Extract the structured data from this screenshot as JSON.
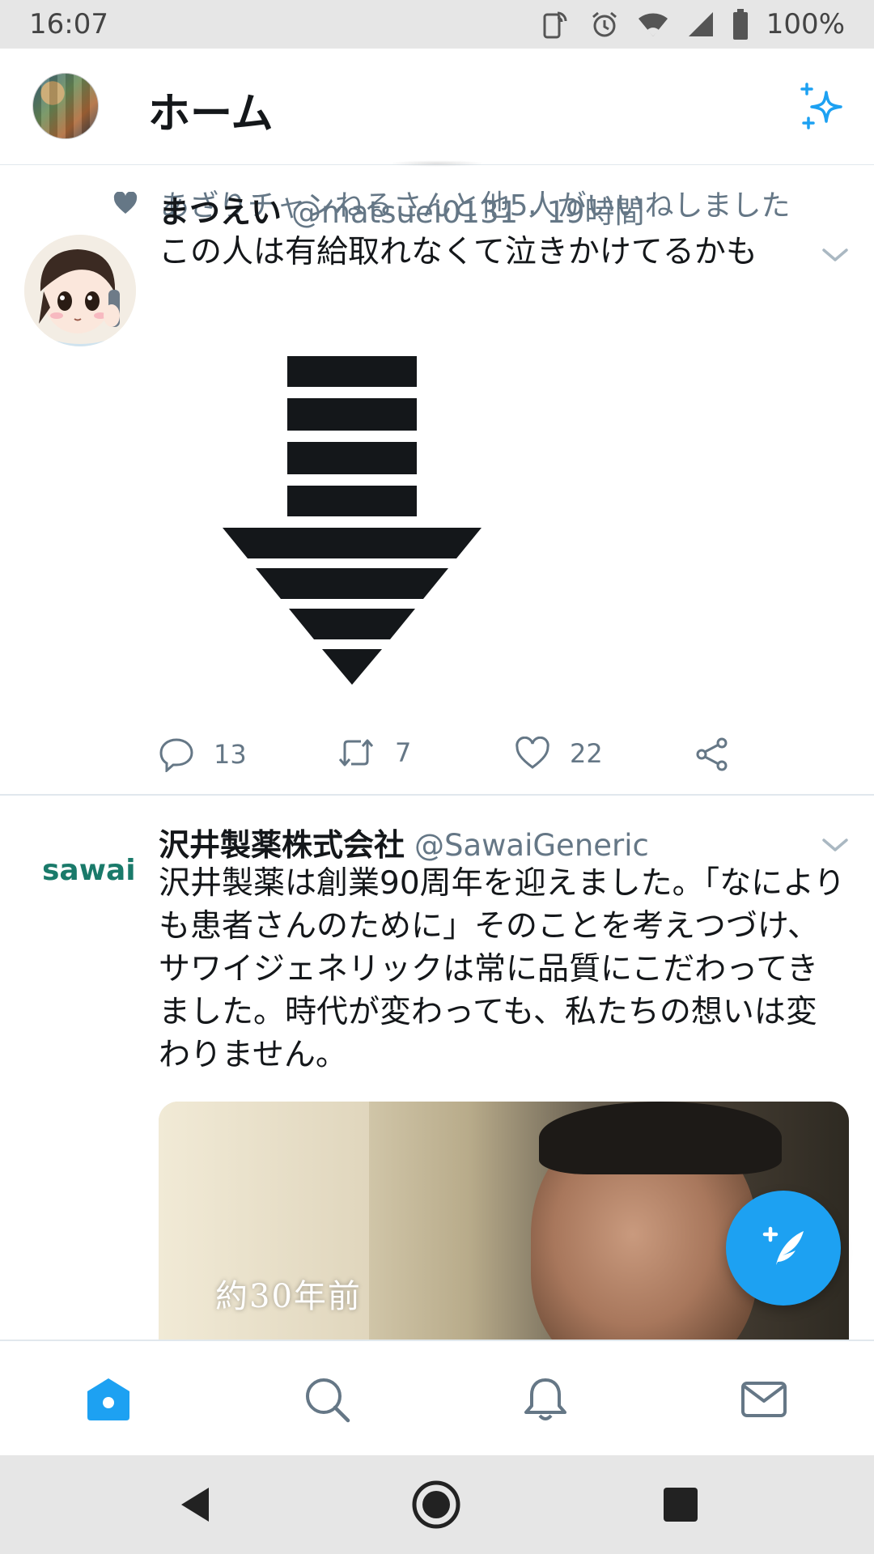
{
  "status_bar": {
    "time": "16:07",
    "battery": "100%",
    "icons": [
      "nfc-icon",
      "alarm-icon",
      "wifi-icon",
      "signal-icon",
      "battery-icon"
    ]
  },
  "header": {
    "title": "ホーム",
    "avatar_icon": "profile-avatar",
    "sparkle_icon": "sparkle-icon"
  },
  "feed": {
    "tweets": [
      {
        "social_context": "あざりチャンねるさんと他5人がいいねしました",
        "display_name": "まつえい",
        "handle": "@matsuei0131 · 19時間",
        "text": "この人は有給取れなくて泣きかけてるかも",
        "media": "down-arrow-graphic",
        "replies": "13",
        "retweets": "7",
        "likes": "22"
      },
      {
        "logo_text": "sawai",
        "display_name": "沢井製薬株式会社",
        "handle": "@SawaiGeneric",
        "text": "沢井製薬は創業90周年を迎えました。「なによりも患者さんのために」そのことを考えつづけ、サワイジェネリックは常に品質にこだわってきました。時代が変わっても、私たちの想いは変わりません。",
        "media_caption": "約30年前"
      }
    ]
  },
  "tabs": [
    {
      "name": "home-icon",
      "active": true
    },
    {
      "name": "search-icon",
      "active": false
    },
    {
      "name": "notifications-icon",
      "active": false
    },
    {
      "name": "messages-icon",
      "active": false
    }
  ],
  "colors": {
    "accent": "#1da1f2",
    "text_primary": "#14171a",
    "text_secondary": "#657786",
    "sawai_green": "#1a7a6a"
  }
}
